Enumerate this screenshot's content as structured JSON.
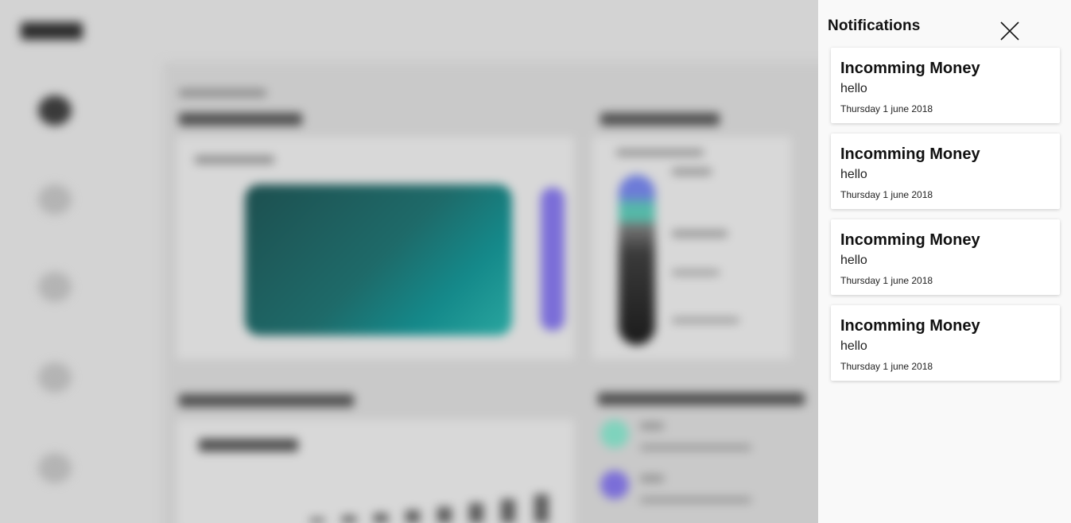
{
  "notifications_panel": {
    "title": "Notifications",
    "close_icon": "close-icon",
    "items": [
      {
        "title": "Incomming Money",
        "message": "hello",
        "date": "Thursday 1 june 2018"
      },
      {
        "title": "Incomming Money",
        "message": "hello",
        "date": "Thursday 1 june 2018"
      },
      {
        "title": "Incomming Money",
        "message": "hello",
        "date": "Thursday 1 june 2018"
      },
      {
        "title": "Incomming Money",
        "message": "hello",
        "date": "Thursday 1 june 2018"
      }
    ]
  },
  "colors": {
    "overlay": "#d3d3d3",
    "drawer_background": "#f9f9f9",
    "card_background": "#ffffff",
    "card_teal": "#1e6a69",
    "card_purple": "#7b6ed8"
  }
}
